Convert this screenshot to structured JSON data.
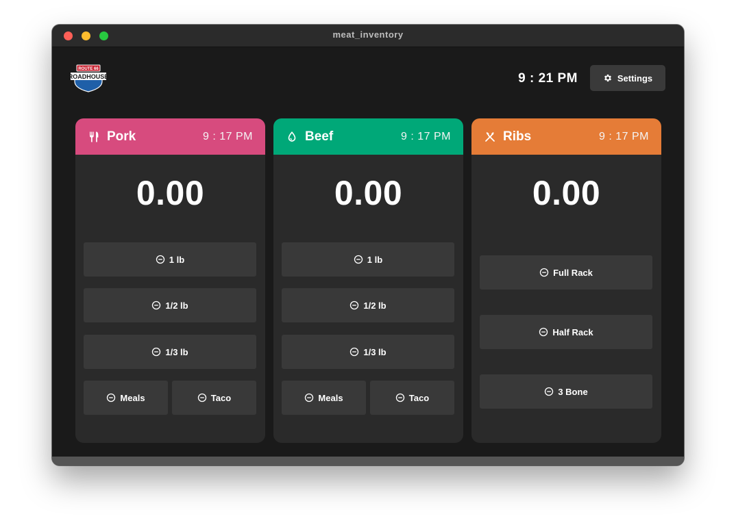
{
  "window": {
    "title": "meat_inventory"
  },
  "header": {
    "clock": "9 : 21 PM",
    "settings_label": "Settings",
    "settings_icon": "gear-icon"
  },
  "logo": {
    "text_top": "ROUTE 66",
    "text_main": "ROADHOUSE"
  },
  "cards": [
    {
      "name": "Pork",
      "time": "9 : 17 PM",
      "value": "0.00",
      "color": "#d74b7e",
      "icon": "fork-knife-icon",
      "buttons": {
        "b1": "1 lb",
        "b2": "1/2 lb",
        "b3": "1/3 lb",
        "meals": "Meals",
        "taco": "Taco"
      }
    },
    {
      "name": "Beef",
      "time": "9 : 17 PM",
      "value": "0.00",
      "color": "#00a878",
      "icon": "drop-icon",
      "buttons": {
        "b1": "1 lb",
        "b2": "1/2 lb",
        "b3": "1/3 lb",
        "meals": "Meals",
        "taco": "Taco"
      }
    },
    {
      "name": "Ribs",
      "time": "9 : 17 PM",
      "value": "0.00",
      "color": "#e57c37",
      "icon": "crossed-utensils-icon",
      "buttons": {
        "full": "Full Rack",
        "half": "Half Rack",
        "bone": "3 Bone"
      }
    }
  ]
}
